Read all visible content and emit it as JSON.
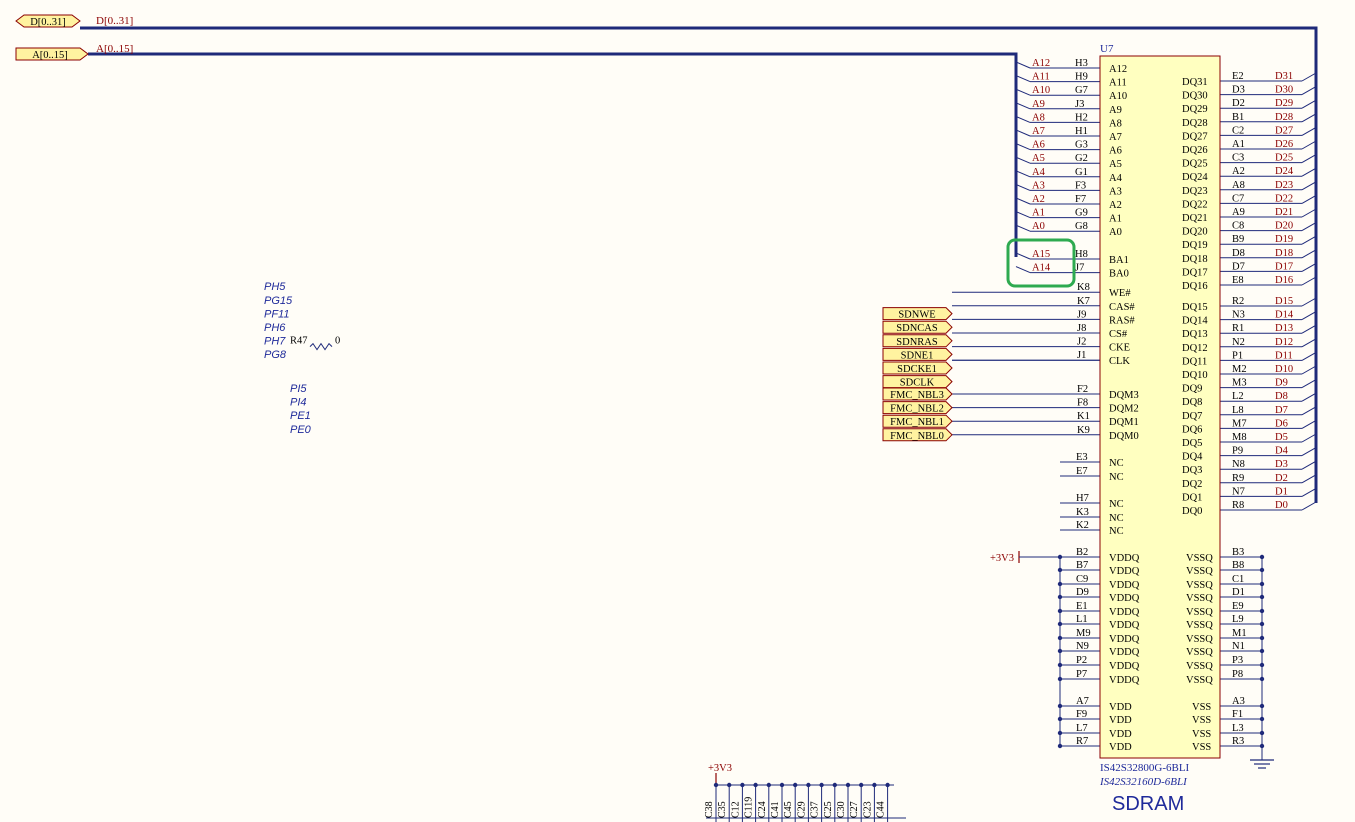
{
  "colors": {
    "background": "#fffdf7",
    "bus": "#1f2a7a",
    "wire": "#1f2a7a",
    "net_label": "#8b0000",
    "pin_text": "#000000",
    "component_fill": "#ffffc0",
    "component_stroke": "#8b0000",
    "port_fill": "#fff3a0",
    "port_stroke": "#8b0000",
    "italic_net": "#1f2a9a",
    "highlight": "#2eaa50"
  },
  "buses": {
    "d_port": "D[0..31]",
    "d_bus": "D[0..31]",
    "a_port": "A[0..15]",
    "a_bus": "A[0..15]"
  },
  "component": {
    "designator": "U7",
    "part1": "IS42S32800G-6BLI",
    "part2": "IS42S32160D-6BLI",
    "title": "SDRAM"
  },
  "address_pins": [
    {
      "net": "A12",
      "ball": "H3",
      "pin": "A12"
    },
    {
      "net": "A11",
      "ball": "H9",
      "pin": "A11"
    },
    {
      "net": "A10",
      "ball": "G7",
      "pin": "A10"
    },
    {
      "net": "A9",
      "ball": "J3",
      "pin": "A9"
    },
    {
      "net": "A8",
      "ball": "H2",
      "pin": "A8"
    },
    {
      "net": "A7",
      "ball": "H1",
      "pin": "A7"
    },
    {
      "net": "A6",
      "ball": "G3",
      "pin": "A6"
    },
    {
      "net": "A5",
      "ball": "G2",
      "pin": "A5"
    },
    {
      "net": "A4",
      "ball": "G1",
      "pin": "A4"
    },
    {
      "net": "A3",
      "ball": "F3",
      "pin": "A3"
    },
    {
      "net": "A2",
      "ball": "F7",
      "pin": "A2"
    },
    {
      "net": "A1",
      "ball": "G9",
      "pin": "A1"
    },
    {
      "net": "A0",
      "ball": "G8",
      "pin": "A0"
    }
  ],
  "bank_pins": [
    {
      "net": "A15",
      "ball": "H8",
      "pin": "BA1"
    },
    {
      "net": "A14",
      "ball": "J7",
      "pin": "BA0"
    }
  ],
  "control_pins": [
    {
      "port": "",
      "net": "PH5",
      "ball": "K8",
      "pin": "WE#"
    },
    {
      "port": "SDNWE",
      "net": "PG15",
      "ball": "K7",
      "pin": "CAS#"
    },
    {
      "port": "SDNCAS",
      "net": "PF11",
      "ball": "J9",
      "pin": "RAS#"
    },
    {
      "port": "SDNRAS",
      "net": "PH6",
      "ball": "J8",
      "pin": "CS#"
    },
    {
      "port": "SDNE1",
      "net": "PH7",
      "ball": "J2",
      "pin": "CKE"
    },
    {
      "port": "SDCKE1",
      "net": "PG8",
      "ball": "J1",
      "pin": "CLK"
    },
    {
      "port": "SDCLK",
      "net": "",
      "ball": "",
      "pin": ""
    }
  ],
  "resistor": {
    "ref": "R47",
    "value": "0"
  },
  "dqm_pins": [
    {
      "port": "FMC_NBL3",
      "net": "PI5",
      "ball": "F2",
      "pin": "DQM3"
    },
    {
      "port": "FMC_NBL2",
      "net": "PI4",
      "ball": "F8",
      "pin": "DQM2"
    },
    {
      "port": "FMC_NBL1",
      "net": "PE1",
      "ball": "K1",
      "pin": "DQM1"
    },
    {
      "port": "FMC_NBL0",
      "net": "PE0",
      "ball": "K9",
      "pin": "DQM0"
    }
  ],
  "nc_pins": [
    {
      "ball": "E3",
      "pin": "NC"
    },
    {
      "ball": "E7",
      "pin": "NC"
    },
    {
      "ball": "H7",
      "pin": "NC"
    },
    {
      "ball": "K3",
      "pin": "NC"
    },
    {
      "ball": "K2",
      "pin": "NC"
    }
  ],
  "power_net": "+3V3",
  "vddq_pins": [
    {
      "ball": "B2",
      "pin": "VDDQ"
    },
    {
      "ball": "B7",
      "pin": "VDDQ"
    },
    {
      "ball": "C9",
      "pin": "VDDQ"
    },
    {
      "ball": "D9",
      "pin": "VDDQ"
    },
    {
      "ball": "E1",
      "pin": "VDDQ"
    },
    {
      "ball": "L1",
      "pin": "VDDQ"
    },
    {
      "ball": "M9",
      "pin": "VDDQ"
    },
    {
      "ball": "N9",
      "pin": "VDDQ"
    },
    {
      "ball": "P2",
      "pin": "VDDQ"
    },
    {
      "ball": "P7",
      "pin": "VDDQ"
    }
  ],
  "vdd_pins": [
    {
      "ball": "A7",
      "pin": "VDD"
    },
    {
      "ball": "F9",
      "pin": "VDD"
    },
    {
      "ball": "L7",
      "pin": "VDD"
    },
    {
      "ball": "R7",
      "pin": "VDD"
    }
  ],
  "data_pins": [
    {
      "pin": "DQ31",
      "ball": "E2",
      "net": "D31"
    },
    {
      "pin": "DQ30",
      "ball": "D3",
      "net": "D30"
    },
    {
      "pin": "DQ29",
      "ball": "D2",
      "net": "D29"
    },
    {
      "pin": "DQ28",
      "ball": "B1",
      "net": "D28"
    },
    {
      "pin": "DQ27",
      "ball": "C2",
      "net": "D27"
    },
    {
      "pin": "DQ26",
      "ball": "A1",
      "net": "D26"
    },
    {
      "pin": "DQ25",
      "ball": "C3",
      "net": "D25"
    },
    {
      "pin": "DQ24",
      "ball": "A2",
      "net": "D24"
    },
    {
      "pin": "DQ23",
      "ball": "A8",
      "net": "D23"
    },
    {
      "pin": "DQ22",
      "ball": "C7",
      "net": "D22"
    },
    {
      "pin": "DQ21",
      "ball": "A9",
      "net": "D21"
    },
    {
      "pin": "DQ20",
      "ball": "C8",
      "net": "D20"
    },
    {
      "pin": "DQ19",
      "ball": "B9",
      "net": "D19"
    },
    {
      "pin": "DQ18",
      "ball": "D8",
      "net": "D18"
    },
    {
      "pin": "DQ17",
      "ball": "D7",
      "net": "D17"
    },
    {
      "pin": "DQ16",
      "ball": "E8",
      "net": "D16"
    },
    {
      "pin": "DQ15",
      "ball": "R2",
      "net": "D15"
    },
    {
      "pin": "DQ14",
      "ball": "N3",
      "net": "D14"
    },
    {
      "pin": "DQ13",
      "ball": "R1",
      "net": "D13"
    },
    {
      "pin": "DQ12",
      "ball": "N2",
      "net": "D12"
    },
    {
      "pin": "DQ11",
      "ball": "P1",
      "net": "D11"
    },
    {
      "pin": "DQ10",
      "ball": "M2",
      "net": "D10"
    },
    {
      "pin": "DQ9",
      "ball": "M3",
      "net": "D9"
    },
    {
      "pin": "DQ8",
      "ball": "L2",
      "net": "D8"
    },
    {
      "pin": "DQ7",
      "ball": "L8",
      "net": "D7"
    },
    {
      "pin": "DQ6",
      "ball": "M7",
      "net": "D6"
    },
    {
      "pin": "DQ5",
      "ball": "M8",
      "net": "D5"
    },
    {
      "pin": "DQ4",
      "ball": "P9",
      "net": "D4"
    },
    {
      "pin": "DQ3",
      "ball": "N8",
      "net": "D3"
    },
    {
      "pin": "DQ2",
      "ball": "R9",
      "net": "D2"
    },
    {
      "pin": "DQ1",
      "ball": "N7",
      "net": "D1"
    },
    {
      "pin": "DQ0",
      "ball": "R8",
      "net": "D0"
    }
  ],
  "vssq_pins": [
    {
      "pin": "VSSQ",
      "ball": "B3"
    },
    {
      "pin": "VSSQ",
      "ball": "B8"
    },
    {
      "pin": "VSSQ",
      "ball": "C1"
    },
    {
      "pin": "VSSQ",
      "ball": "D1"
    },
    {
      "pin": "VSSQ",
      "ball": "E9"
    },
    {
      "pin": "VSSQ",
      "ball": "L9"
    },
    {
      "pin": "VSSQ",
      "ball": "M1"
    },
    {
      "pin": "VSSQ",
      "ball": "N1"
    },
    {
      "pin": "VSSQ",
      "ball": "P3"
    },
    {
      "pin": "VSSQ",
      "ball": "P8"
    }
  ],
  "vss_pins": [
    {
      "pin": "VSS",
      "ball": "A3"
    },
    {
      "pin": "VSS",
      "ball": "F1"
    },
    {
      "pin": "VSS",
      "ball": "L3"
    },
    {
      "pin": "VSS",
      "ball": "R3"
    }
  ],
  "decoupling": {
    "net": "+3V3",
    "caps": [
      "C38",
      "C35",
      "C12",
      "C119",
      "C24",
      "C41",
      "C45",
      "C29",
      "C37",
      "C25",
      "C30",
      "C27",
      "C23",
      "C44"
    ]
  }
}
